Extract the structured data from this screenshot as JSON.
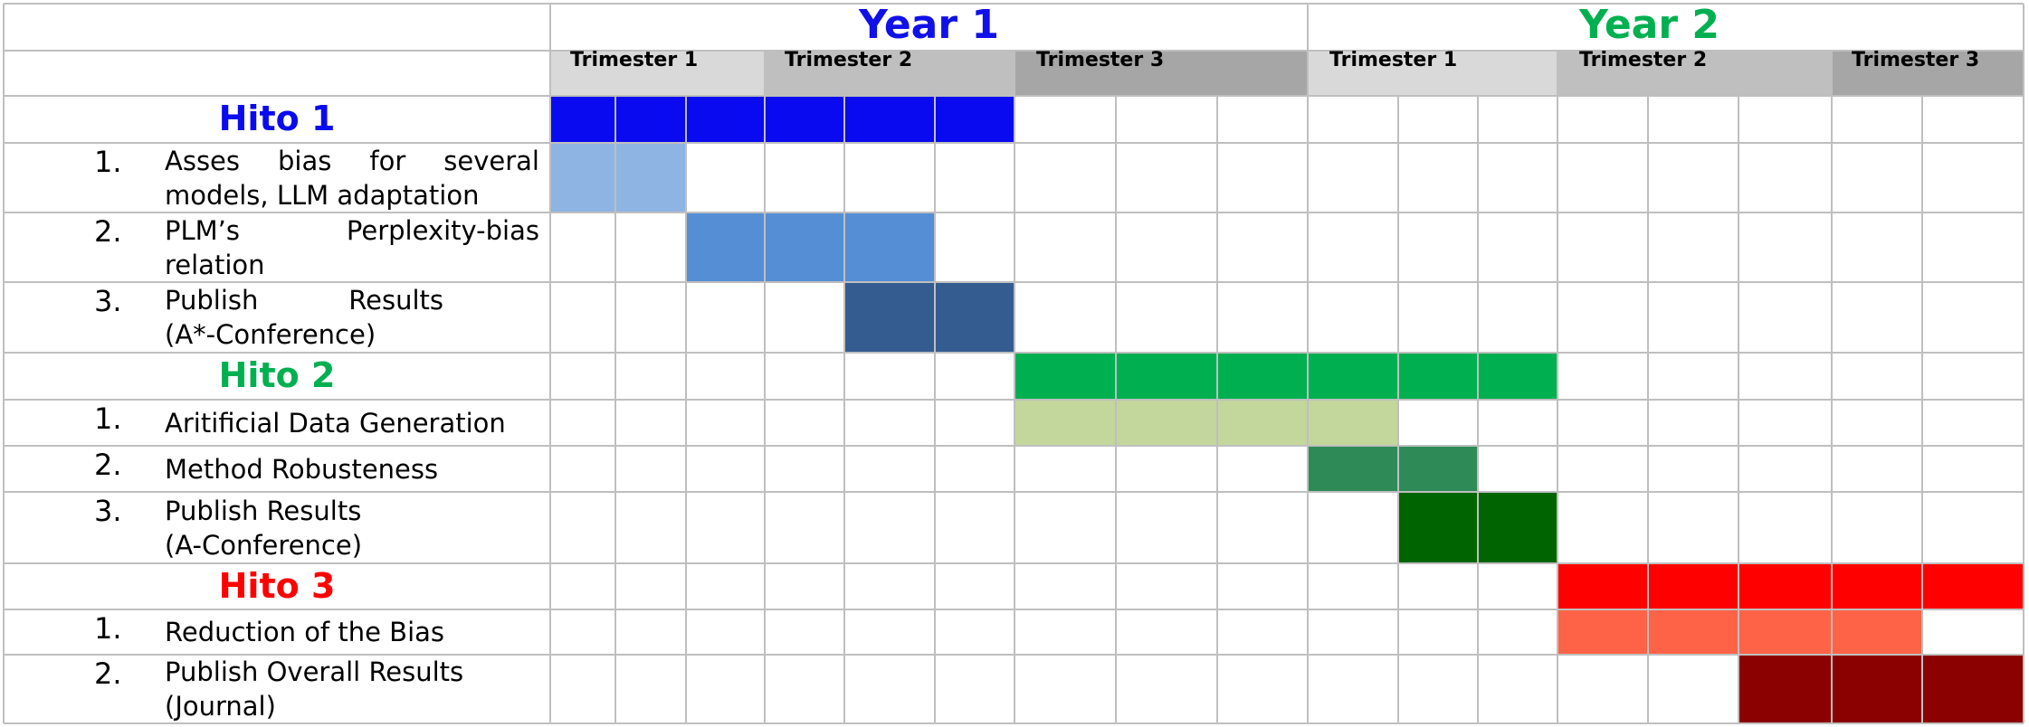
{
  "header": {
    "years": [
      {
        "label": "Year 1",
        "color": "#1010E8"
      },
      {
        "label": "Year 2",
        "color": "#00B050"
      }
    ],
    "trimesters": [
      {
        "label": "Trimester 1",
        "shade": "#D9D9D9"
      },
      {
        "label": "Trimester 2",
        "shade": "#BFBFBF"
      },
      {
        "label": "Trimester 3",
        "shade": "#A6A6A6"
      },
      {
        "label": "Trimester 1",
        "shade": "#D9D9D9"
      },
      {
        "label": "Trimester 2",
        "shade": "#BFBFBF"
      },
      {
        "label": "Trimester 3",
        "shade": "#A6A6A6"
      }
    ]
  },
  "milestones": [
    {
      "title": "Hito 1",
      "color": "#0A0AF0",
      "bar": [
        0,
        5
      ],
      "tasks": [
        {
          "number": "1.",
          "text_lines": [
            [
              "Asses",
              "bias",
              "for",
              "several"
            ],
            [
              "models, LLM adaptation"
            ]
          ],
          "color": "#8EB4E3",
          "bar": [
            0,
            1
          ]
        },
        {
          "number": "2.",
          "text_lines": [
            [
              "PLM’s",
              "Perplexity-bias"
            ],
            [
              "relation"
            ]
          ],
          "color": "#558ED5",
          "bar": [
            2,
            4
          ]
        },
        {
          "number": "3.",
          "text_lines": [
            [
              "Publish",
              "Results"
            ],
            [
              "(A*-Conference)"
            ]
          ],
          "color": "#345C91",
          "bar": [
            4,
            5
          ]
        }
      ]
    },
    {
      "title": "Hito 2",
      "color": "#00B050",
      "bar": [
        6,
        11
      ],
      "tasks": [
        {
          "number": "1.",
          "text_lines": [
            [
              "Aritificial Data Generation"
            ]
          ],
          "color": "#C3D69B",
          "bar": [
            6,
            9
          ]
        },
        {
          "number": "2.",
          "text_lines": [
            [
              "Method Robusteness"
            ]
          ],
          "color": "#2E8B57",
          "bar": [
            9,
            10
          ]
        },
        {
          "number": "3.",
          "text_lines": [
            [
              "Publish Results"
            ],
            [
              "(A-Conference)"
            ]
          ],
          "color": "#006400",
          "bar": [
            10,
            11
          ]
        }
      ]
    },
    {
      "title": "Hito 3",
      "color": "#FF0000",
      "bar": [
        12,
        16
      ],
      "tasks": [
        {
          "number": "1.",
          "text_lines": [
            [
              "Reduction of the Bias"
            ]
          ],
          "color": "#FF6347",
          "bar": [
            12,
            15
          ]
        },
        {
          "number": "2.",
          "text_lines": [
            [
              "Publish Overall Results"
            ],
            [
              "(Journal)"
            ]
          ],
          "color": "#8B0000",
          "bar": [
            14,
            16
          ]
        }
      ]
    }
  ]
}
